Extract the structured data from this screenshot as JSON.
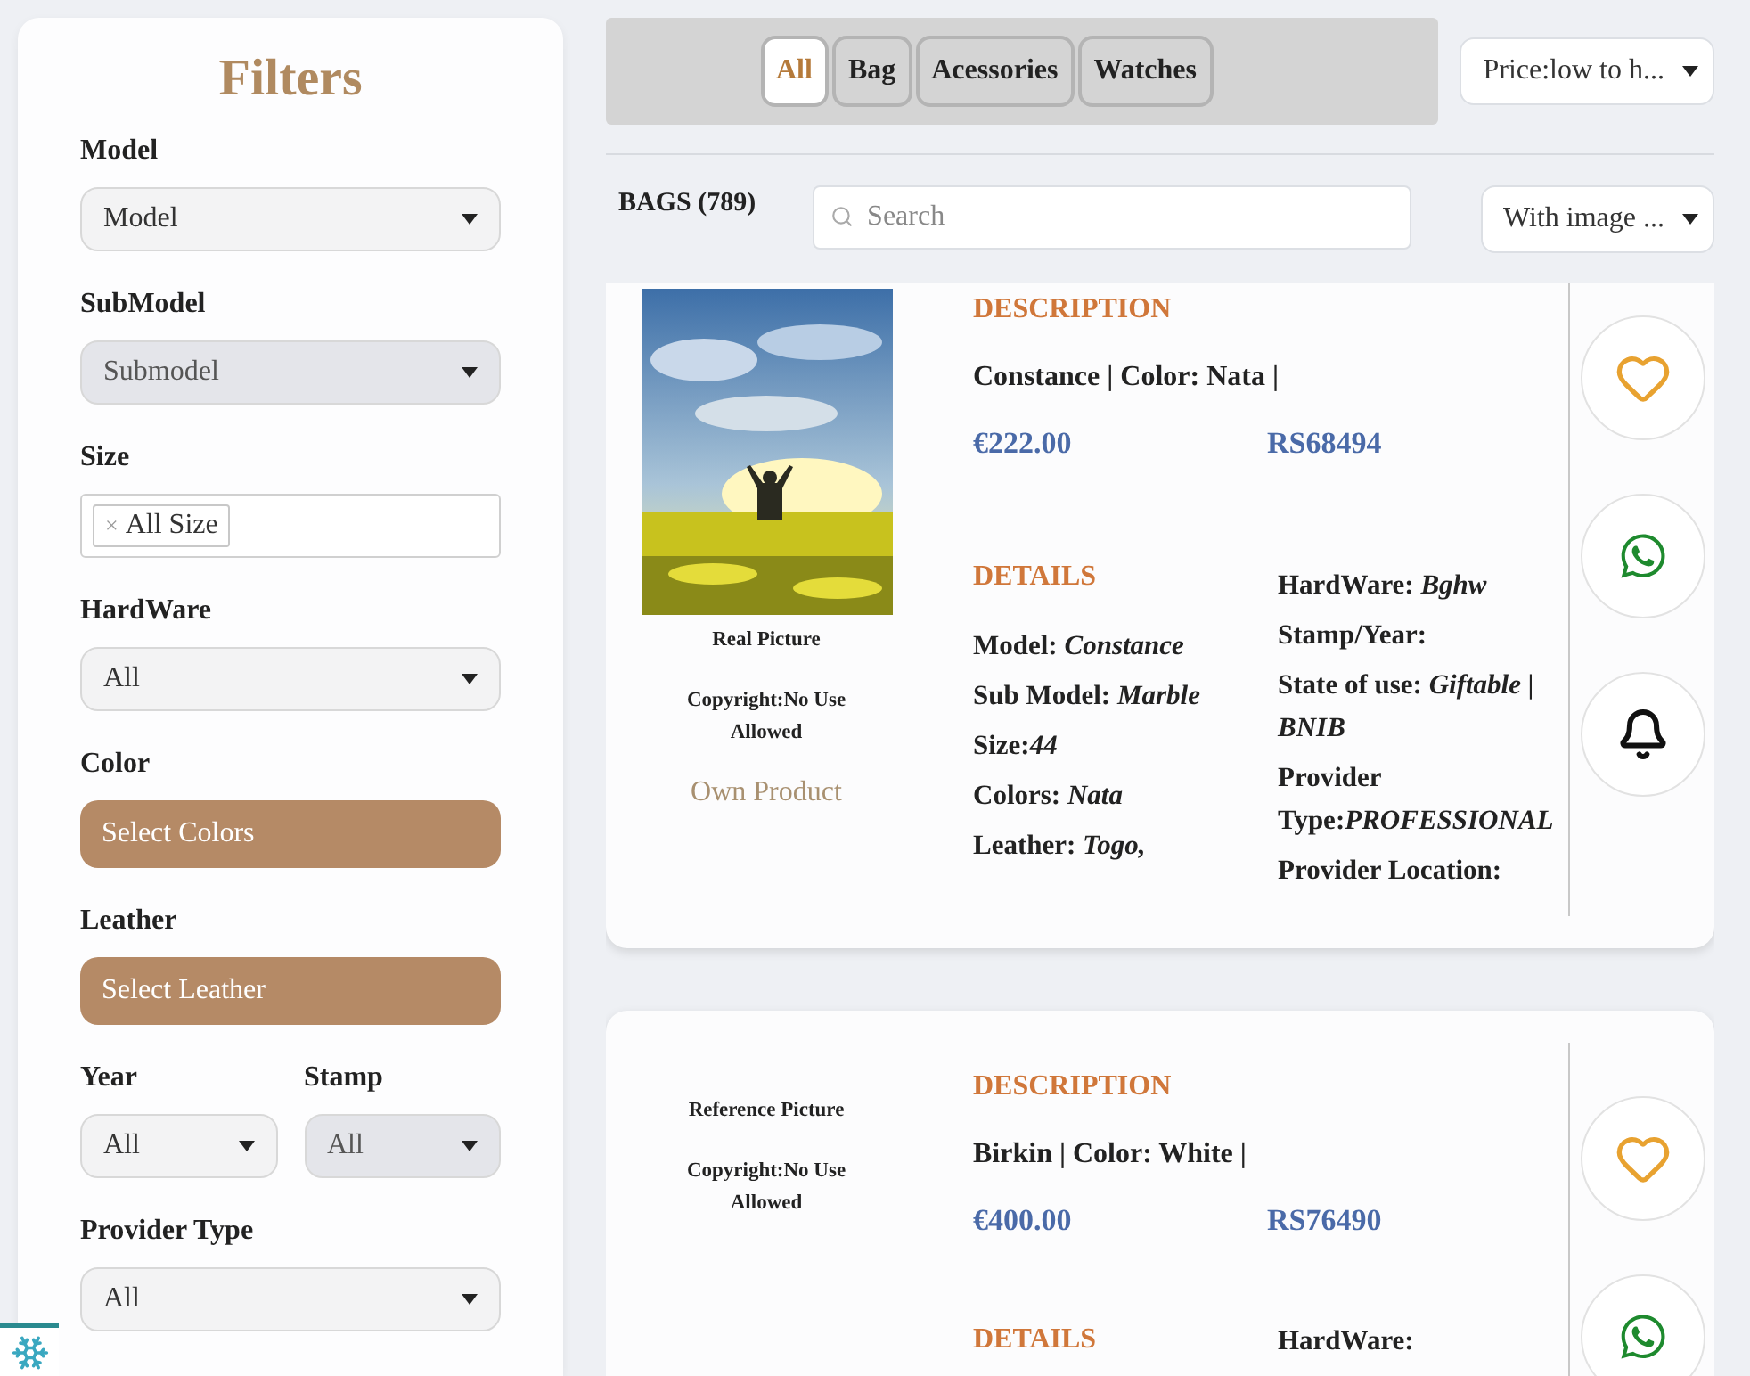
{
  "sidebar": {
    "title": "Filters",
    "filters": [
      {
        "kind": "select",
        "label": "Model",
        "value": "Model",
        "disabled": false
      },
      {
        "kind": "select",
        "label": "SubModel",
        "value": "Submodel",
        "disabled": true
      },
      {
        "kind": "tags",
        "label": "Size",
        "tags": [
          {
            "remove": "×",
            "label": "All Size"
          }
        ]
      },
      {
        "kind": "select",
        "label": "HardWare",
        "value": "All",
        "disabled": false
      },
      {
        "kind": "button",
        "label": "Color",
        "value": "Select Colors"
      },
      {
        "kind": "button",
        "label": "Leather",
        "value": "Select Leather"
      },
      {
        "kind": "pair",
        "items": [
          {
            "label": "Year",
            "value": "All",
            "disabled": false
          },
          {
            "label": "Stamp",
            "value": "All",
            "disabled": true
          }
        ]
      },
      {
        "kind": "select",
        "label": "Provider Type",
        "value": "All",
        "disabled": false
      }
    ]
  },
  "tabs": [
    {
      "label": "All",
      "selected": true
    },
    {
      "label": "Bag",
      "selected": false
    },
    {
      "label": "Acessories",
      "selected": false
    },
    {
      "label": "Watches",
      "selected": false
    }
  ],
  "sort": {
    "value": "Price:low to h..."
  },
  "count_label": "BAGS (789)",
  "search": {
    "placeholder": "Search"
  },
  "image_filter": {
    "value": "With image ..."
  },
  "products": [
    {
      "image": {
        "kind": "picture"
      },
      "picture_label": "Real Picture",
      "copyright": "Copyright:No Use Allowed",
      "ownership": "Own Product",
      "description_heading": "DESCRIPTION",
      "title": "Constance | Color: Nata |",
      "price_eur": "€222.00",
      "price_rs": "RS68494",
      "details_heading": "DETAILS",
      "details_left": [
        "Model: *Constance*",
        "Sub Model: *Marble*",
        "Size:*44*",
        "Colors: *Nata*",
        "Leather: *Togo,*"
      ],
      "details_right": [
        "HardWare: *Bghw*",
        "Stamp/Year:",
        "State of use: *Giftable | BNIB*",
        "Provider Type:*PROFESSIONAL*",
        "Provider Location:"
      ],
      "actions": [
        {
          "kind": "favorite"
        },
        {
          "kind": "whatsapp"
        },
        {
          "kind": "notify"
        }
      ]
    },
    {
      "picture_label": "Reference Picture",
      "copyright": "Copyright:No Use Allowed",
      "description_heading": "DESCRIPTION",
      "title": "Birkin | Color: White |",
      "price_eur": "€400.00",
      "price_rs": "RS76490",
      "details_heading": "DETAILS",
      "details_right": [
        "HardWare:"
      ],
      "actions": [
        {
          "kind": "favorite"
        },
        {
          "kind": "whatsapp"
        }
      ]
    }
  ]
}
